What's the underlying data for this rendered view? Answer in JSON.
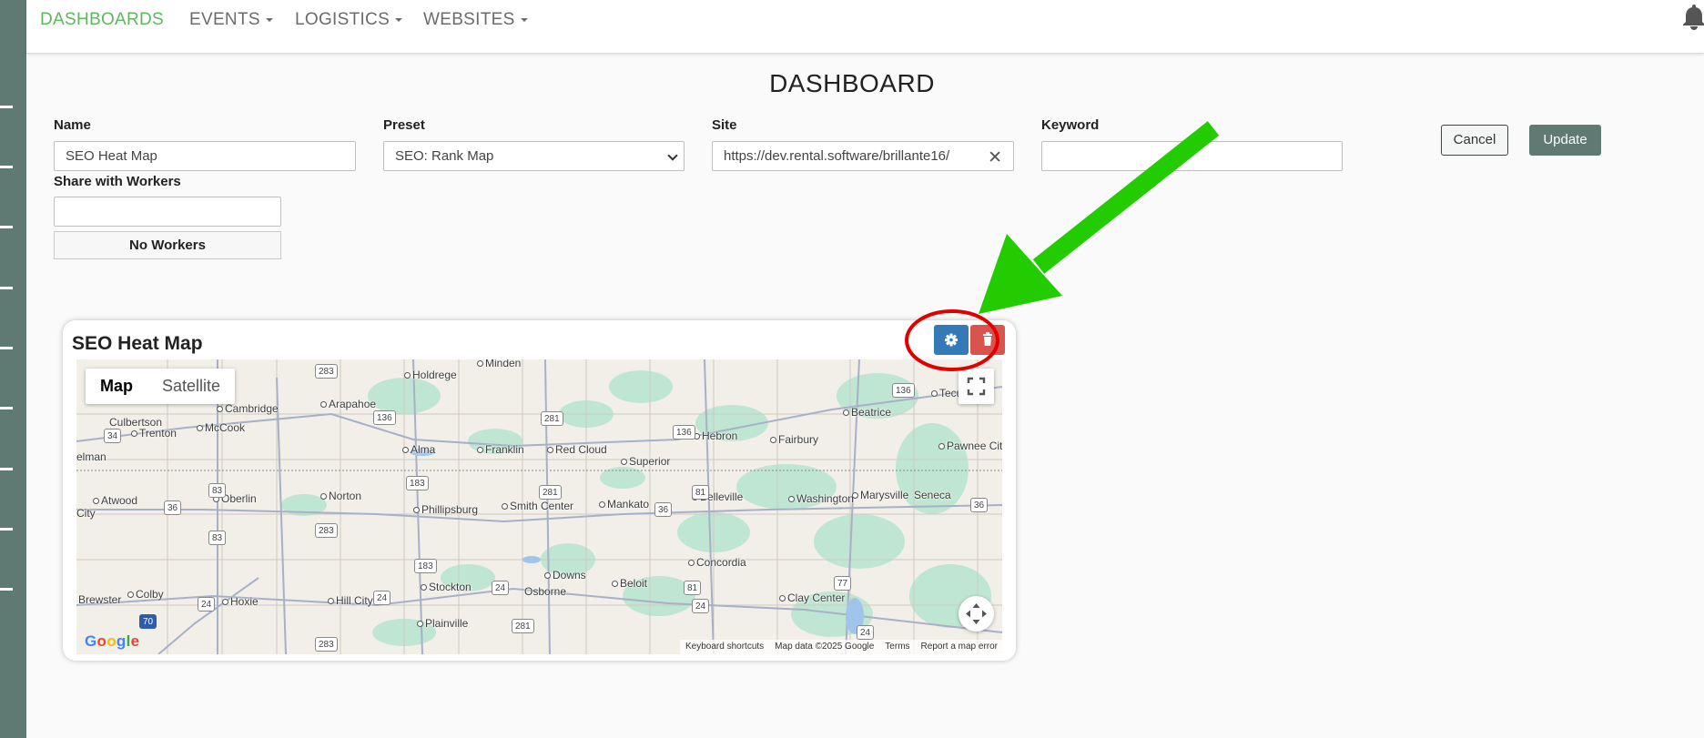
{
  "nav": {
    "items": [
      {
        "label": "DASHBOARDS",
        "active": true
      },
      {
        "label": "EVENTS",
        "active": false
      },
      {
        "label": "LOGISTICS",
        "active": false
      },
      {
        "label": "WEBSITES",
        "active": false
      }
    ],
    "bell_icon": "bell-icon"
  },
  "page_title": "DASHBOARD",
  "form": {
    "name_label": "Name",
    "name_value": "SEO Heat Map",
    "preset_label": "Preset",
    "preset_value": "SEO: Rank Map",
    "site_label": "Site",
    "site_value": "https://dev.rental.software/brillante16/",
    "keyword_label": "Keyword",
    "keyword_value": "",
    "share_label": "Share with Workers",
    "share_value": "",
    "no_workers": "No Workers",
    "cancel_label": "Cancel",
    "update_label": "Update"
  },
  "widget": {
    "title": "SEO Heat Map",
    "settings_icon": "gear-icon",
    "delete_icon": "trash-icon"
  },
  "map": {
    "type_map": "Map",
    "type_satellite": "Satellite",
    "places": [
      "Minden",
      "Holdrege",
      "Arapahoe",
      "Cambridge",
      "Culbertson",
      "Trenton",
      "McCook",
      "Alma",
      "Franklin",
      "Red Cloud",
      "Hebron",
      "Fairbury",
      "Beatrice",
      "Tecumseh",
      "Pawnee City",
      "Superior",
      "elman",
      "Atwood",
      "Oberlin",
      "Norton",
      "Phillipsburg",
      "Smith Center",
      "Mankato",
      "Belleville",
      "Washington",
      "Marysville",
      "Seneca",
      "City",
      "Concordia",
      "Downs",
      "Osborne",
      "Beloit",
      "Clay Center",
      "Brewster",
      "Colby",
      "Hoxie",
      "Hill City",
      "Stockton",
      "Plainville"
    ],
    "shields": [
      "283",
      "136",
      "281",
      "136",
      "34",
      "83",
      "183",
      "281",
      "36",
      "81",
      "83",
      "36",
      "283",
      "83",
      "183",
      "24",
      "24",
      "24",
      "24",
      "81",
      "24",
      "77",
      "70",
      "283",
      "281",
      "136",
      "36"
    ],
    "google": "Google",
    "attribution": [
      "Keyboard shortcuts",
      "Map data ©2025 Google",
      "Terms",
      "Report a map error"
    ]
  },
  "colors": {
    "sidebar": "#5e7a73",
    "nav_active": "#5cb85c",
    "gear_button": "#337ab7",
    "trash_button": "#d9534f",
    "annotation_arrow": "#22cc00",
    "annotation_circle": "#e00000"
  }
}
